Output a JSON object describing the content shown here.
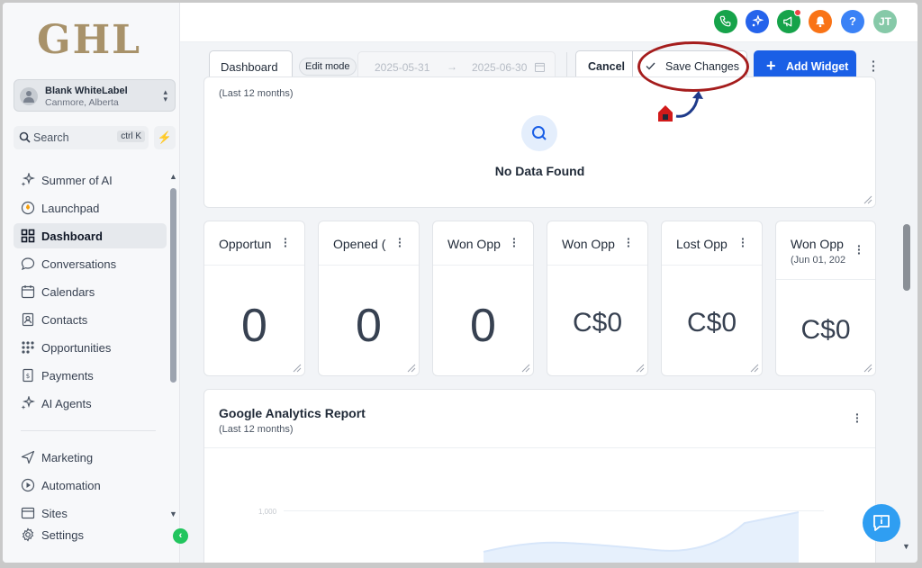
{
  "logo": "GHL",
  "account": {
    "name": "Blank WhiteLabel",
    "location": "Canmore, Alberta"
  },
  "search": {
    "placeholder": "Search",
    "shortcut": "ctrl K"
  },
  "nav": {
    "top": [
      {
        "label": "Summer of AI",
        "icon": "sparkle-icon"
      },
      {
        "label": "Launchpad",
        "icon": "rocket-icon"
      },
      {
        "label": "Dashboard",
        "icon": "grid-icon",
        "active": true
      },
      {
        "label": "Conversations",
        "icon": "chat-icon"
      },
      {
        "label": "Calendars",
        "icon": "calendar-icon"
      },
      {
        "label": "Contacts",
        "icon": "contacts-icon"
      },
      {
        "label": "Opportunities",
        "icon": "funnel-icon"
      },
      {
        "label": "Payments",
        "icon": "payments-icon"
      },
      {
        "label": "AI Agents",
        "icon": "sparkle-icon"
      }
    ],
    "bottom": [
      {
        "label": "Marketing",
        "icon": "send-icon"
      },
      {
        "label": "Automation",
        "icon": "automation-icon"
      },
      {
        "label": "Sites",
        "icon": "sites-icon"
      },
      {
        "label": "Settings",
        "icon": "gear-icon"
      }
    ]
  },
  "topbar": {
    "avatar_initials": "JT",
    "icons": [
      {
        "name": "phone-icon",
        "color": "#16a34a"
      },
      {
        "name": "magic-icon",
        "color": "#2563eb"
      },
      {
        "name": "megaphone-icon",
        "color": "#16a34a"
      },
      {
        "name": "bell-icon",
        "color": "#f97316"
      },
      {
        "name": "help-icon",
        "color": "#3b82f6",
        "glyph": "?"
      }
    ]
  },
  "toolbar": {
    "dashboard_label": "Dashboard",
    "edit_mode_label": "Edit mode",
    "date_start": "2025-05-31",
    "date_end": "2025-06-30",
    "cancel_label": "Cancel",
    "save_label": "Save Changes",
    "add_widget_label": "Add Widget",
    "accent_color": "#1a5fe6"
  },
  "empty_card": {
    "subtitle": "(Last 12 months)",
    "message": "No Data Found"
  },
  "stats": [
    {
      "title": "Opportun",
      "value": "0"
    },
    {
      "title": "Opened (",
      "value": "0"
    },
    {
      "title": "Won Opp",
      "value": "0"
    },
    {
      "title": "Won Opp",
      "value": "C$0"
    },
    {
      "title": "Lost Opp",
      "value": "C$0"
    },
    {
      "title": "Won Opp",
      "subtitle": "(Jun 01, 202",
      "value": "C$0"
    }
  ],
  "analytics": {
    "title": "Google Analytics Report",
    "subtitle": "(Last 12 months)",
    "y_tick": "1,000"
  }
}
